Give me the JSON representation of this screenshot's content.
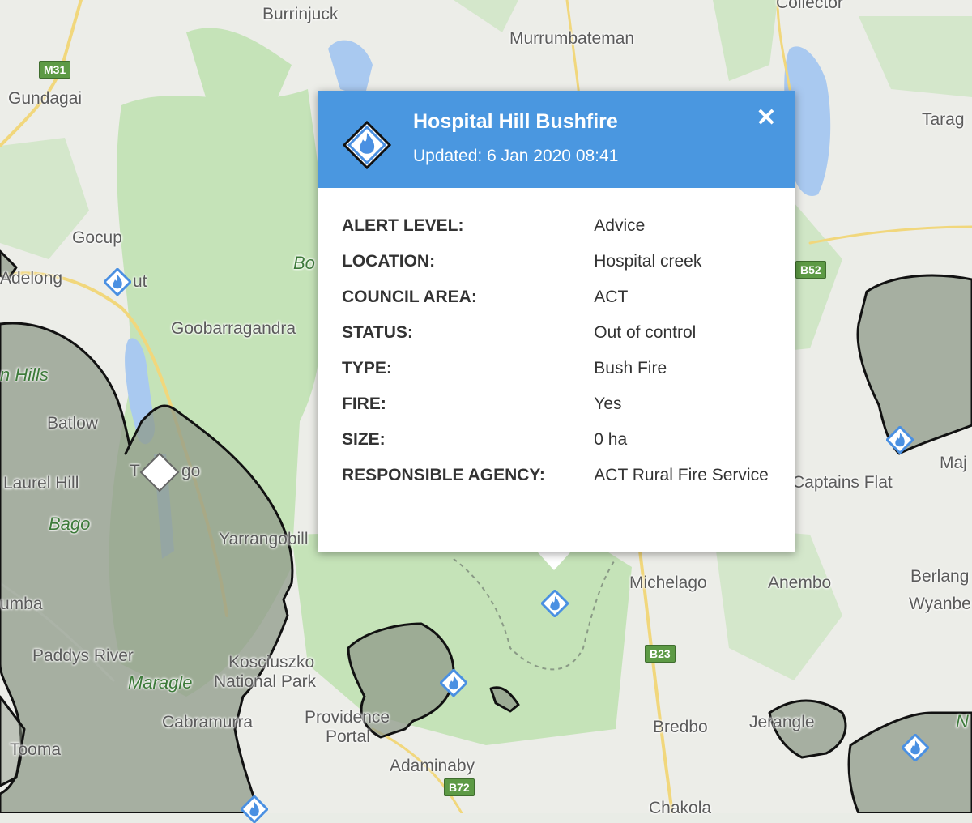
{
  "map": {
    "places": [
      {
        "id": "burrinjuck",
        "label": "Burrinjuck"
      },
      {
        "id": "murrumbateman",
        "label": "Murrumbateman"
      },
      {
        "id": "collector",
        "label": "Collector"
      },
      {
        "id": "gundagai",
        "label": "Gundagai"
      },
      {
        "id": "tarago",
        "label": "Tarag"
      },
      {
        "id": "gocup",
        "label": "Gocup"
      },
      {
        "id": "adelong",
        "label": "Adelong"
      },
      {
        "id": "tumut",
        "label": "ut"
      },
      {
        "id": "goobarragandra",
        "label": "Goobarragandra"
      },
      {
        "id": "hills",
        "label": "n Hills"
      },
      {
        "id": "batlow",
        "label": "Batlow"
      },
      {
        "id": "laurel-hill",
        "label": "Laurel Hill"
      },
      {
        "id": "bago",
        "label": "Bago"
      },
      {
        "id": "talbingo",
        "label": "T"
      },
      {
        "id": "talbingo2",
        "label": "go"
      },
      {
        "id": "yarrangobilly",
        "label": "Yarrangobill"
      },
      {
        "id": "tumbarumba",
        "label": "umba"
      },
      {
        "id": "paddys-river",
        "label": "Paddys River"
      },
      {
        "id": "maragle",
        "label": "Maragle"
      },
      {
        "id": "kosciuszko",
        "label": "Kosciuszko"
      },
      {
        "id": "national-park",
        "label": "National Park"
      },
      {
        "id": "cabramurra",
        "label": "Cabramurra"
      },
      {
        "id": "providence",
        "label": "Providence"
      },
      {
        "id": "portal",
        "label": "Portal"
      },
      {
        "id": "tooma",
        "label": "Tooma"
      },
      {
        "id": "adaminaby",
        "label": "Adaminaby"
      },
      {
        "id": "bo",
        "label": "Bo"
      },
      {
        "id": "michelago",
        "label": "Michelago"
      },
      {
        "id": "anembo",
        "label": "Anembo"
      },
      {
        "id": "berlang",
        "label": "Berlang"
      },
      {
        "id": "wyanbe",
        "label": "Wyanbe"
      },
      {
        "id": "captains-flat",
        "label": "Captains Flat"
      },
      {
        "id": "maj",
        "label": "Maj"
      },
      {
        "id": "bredbo",
        "label": "Bredbo"
      },
      {
        "id": "jerangle",
        "label": "Jerangle"
      },
      {
        "id": "chakola",
        "label": "Chakola"
      },
      {
        "id": "na",
        "label": "N"
      }
    ],
    "shields": [
      {
        "id": "m31",
        "label": "M31"
      },
      {
        "id": "b52",
        "label": "B52"
      },
      {
        "id": "b23",
        "label": "B23"
      },
      {
        "id": "b72",
        "label": "B72"
      }
    ]
  },
  "popup": {
    "title": "Hospital Hill Bushfire",
    "updated": "Updated: 6 Jan 2020 08:41",
    "close": "✕",
    "rows": [
      {
        "key": "ALERT LEVEL:",
        "value": "Advice"
      },
      {
        "key": "LOCATION:",
        "value": "Hospital creek"
      },
      {
        "key": "COUNCIL AREA:",
        "value": "ACT"
      },
      {
        "key": "STATUS:",
        "value": "Out of control"
      },
      {
        "key": "TYPE:",
        "value": "Bush Fire"
      },
      {
        "key": "FIRE:",
        "value": "Yes"
      },
      {
        "key": "SIZE:",
        "value": "0 ha"
      },
      {
        "key": "RESPONSIBLE AGENCY:",
        "value": "ACT Rural Fire Service"
      }
    ]
  },
  "colors": {
    "header": "#4a97e0",
    "fire_marker": "#4a90e2",
    "burnt_area": "#8f9a8a",
    "forest": "#c5e3b8"
  }
}
